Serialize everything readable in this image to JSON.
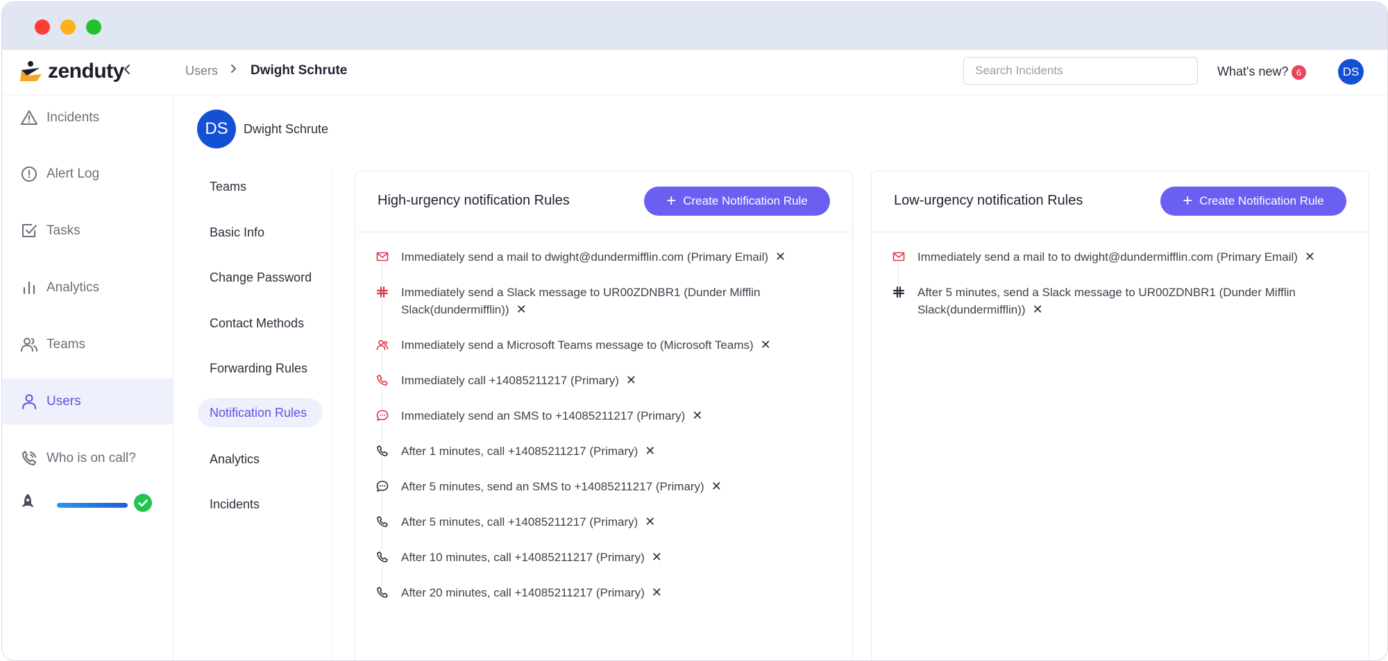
{
  "app": {
    "logo_text": "zenduty",
    "collapse_icon": "chevron-left-icon"
  },
  "breadcrumb": {
    "parent": "Users",
    "separator": "›",
    "current": "Dwight Schrute"
  },
  "header": {
    "search_placeholder": "Search Incidents",
    "whats_new_label": "What's new?",
    "whats_new_count": "6",
    "user_initials": "DS"
  },
  "sidebar": {
    "items": [
      {
        "label": "Incidents",
        "icon": "warning-triangle-icon"
      },
      {
        "label": "Alert Log",
        "icon": "alert-circle-icon"
      },
      {
        "label": "Tasks",
        "icon": "checkbox-icon"
      },
      {
        "label": "Analytics",
        "icon": "bar-chart-icon"
      },
      {
        "label": "Teams",
        "icon": "users-icon"
      },
      {
        "label": "Users",
        "icon": "user-icon",
        "active": true
      },
      {
        "label": "Who is on call?",
        "icon": "phone-call-icon"
      }
    ],
    "onboarding_progress": 1.0
  },
  "profile": {
    "initials": "DS",
    "name": "Dwight Schrute"
  },
  "subnav": {
    "items": [
      {
        "label": "Teams"
      },
      {
        "label": "Basic Info"
      },
      {
        "label": "Change Password"
      },
      {
        "label": "Contact Methods"
      },
      {
        "label": "Forwarding Rules"
      },
      {
        "label": "Notification Rules",
        "active": true
      },
      {
        "label": "Analytics"
      },
      {
        "label": "Incidents"
      }
    ]
  },
  "high_urgency": {
    "title": "High-urgency notification Rules",
    "create_label": "Create Notification Rule",
    "rules": [
      {
        "icon": "mail-icon",
        "text": "Immediately send a mail to dwight@dundermifflin.com (Primary Email)"
      },
      {
        "icon": "slack-icon",
        "text": "Immediately send a Slack message to UR00ZDNBR1 (Dunder Mifflin Slack(dundermifflin))"
      },
      {
        "icon": "teams-icon",
        "text": "Immediately send a Microsoft Teams message to (Microsoft Teams)"
      },
      {
        "icon": "phone-icon",
        "text": "Immediately call +14085211217 (Primary)"
      },
      {
        "icon": "sms-icon",
        "text": "Immediately send an SMS to +14085211217 (Primary)"
      },
      {
        "icon": "phone-icon",
        "text": "After 1 minutes, call +14085211217 (Primary)"
      },
      {
        "icon": "sms-icon",
        "text": "After 5 minutes, send an SMS to +14085211217 (Primary)"
      },
      {
        "icon": "phone-icon",
        "text": "After 5 minutes, call +14085211217 (Primary)"
      },
      {
        "icon": "phone-icon",
        "text": "After 10 minutes, call +14085211217 (Primary)"
      },
      {
        "icon": "phone-icon",
        "text": "After 20 minutes, call +14085211217 (Primary)"
      }
    ]
  },
  "low_urgency": {
    "title": "Low-urgency notification Rules",
    "create_label": "Create Notification Rule",
    "rules": [
      {
        "icon": "mail-icon",
        "text": "Immediately send a mail to to dwight@dundermifflin.com (Primary Email)"
      },
      {
        "icon": "slack-icon",
        "text": "After 5 minutes, send a Slack message to UR00ZDNBR1 (Dunder Mifflin Slack(dundermifflin))"
      }
    ]
  },
  "remove_glyph": "✕",
  "colors": {
    "accent": "#6a5ff1",
    "avatar": "#1450d4",
    "immediate_icon": "#e0334a",
    "delayed_icon": "#2b2d3a",
    "badge": "#e94458",
    "success": "#25c451"
  }
}
